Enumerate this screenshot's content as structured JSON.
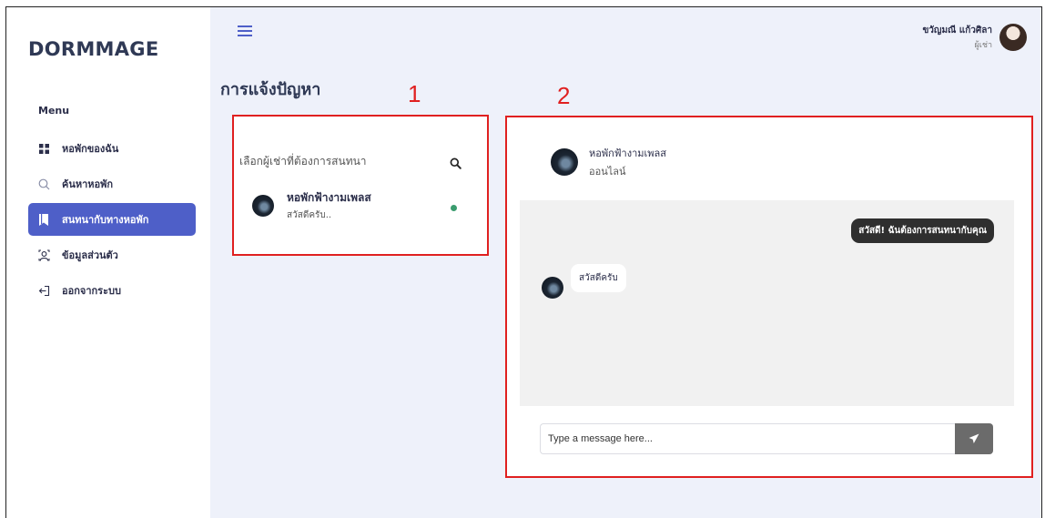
{
  "sidebar": {
    "logo": "DORMMAGE",
    "menu_title": "Menu",
    "items": [
      {
        "label": "หอพักของฉัน",
        "icon": "grid-icon"
      },
      {
        "label": "ค้นหาหอพัก",
        "icon": "search-icon"
      },
      {
        "label": "สนทนากับทางหอพัก",
        "icon": "bookmark-icon",
        "active": true
      },
      {
        "label": "ข้อมูลส่วนตัว",
        "icon": "user-icon"
      },
      {
        "label": "ออกจากระบบ",
        "icon": "logout-icon"
      }
    ]
  },
  "header": {
    "user_name": "ขวัญมณี แก้วศิลา",
    "user_role": "ผู้เช่า"
  },
  "page": {
    "title": "การแจ้งปัญหา",
    "annotation_1": "1",
    "annotation_2": "2"
  },
  "contacts_panel": {
    "search_label": "เลือกผู้เช่าที่ต้องการสนทนา",
    "contacts": [
      {
        "name": "หอพักฟ้างามเพลส",
        "last_message": "สวัสดีครับ..",
        "online": true
      }
    ]
  },
  "chat_panel": {
    "contact_name": "หอพักฟ้างามเพลส",
    "contact_status": "ออนไลน์",
    "messages": [
      {
        "direction": "out",
        "text": "สวัสดี! ฉันต้องการสนทนากับคุณ"
      },
      {
        "direction": "in",
        "text": "สวัสดีครับ"
      }
    ],
    "input_placeholder": "Type a message here..."
  },
  "colors": {
    "accent": "#4e5fc8",
    "annotation": "#e02020",
    "online": "#3a9c6e",
    "main_bg": "#eef1fa"
  }
}
